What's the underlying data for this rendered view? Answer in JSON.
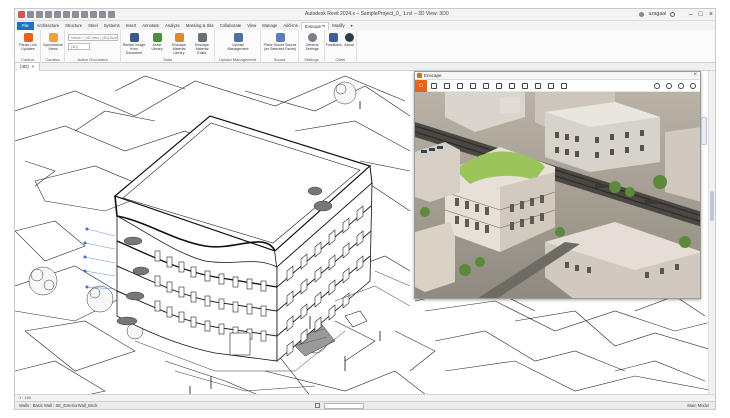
{
  "window": {
    "title": "Autodesk Revit 2024.x – SampleProject_0_ 1.rvt – 3D View: 3D0",
    "user": "uzagaai",
    "controls": [
      "minimize",
      "maximize",
      "close"
    ]
  },
  "ribbon": {
    "tabs": [
      "File",
      "Architecture",
      "Structure",
      "Steel",
      "Systems",
      "Insert",
      "Annotate",
      "Analyze",
      "Massing & Site",
      "Collaborate",
      "View",
      "Manage",
      "Add-Ins",
      "Enscape™",
      "Modify",
      "▾"
    ],
    "active_tab": "Enscape™",
    "groups": [
      {
        "title": "Control",
        "tools": [
          "Pause Live Updates"
        ]
      },
      {
        "title": "Camera",
        "tools": [
          "Synchronize Views"
        ]
      },
      {
        "title": "Active Document",
        "fields": [
          "Views / ( 3D View ) {3D} Active",
          "{3D}"
        ]
      },
      {
        "title": "Tools",
        "tools": [
          "Render Image from Document",
          "Asset Library",
          "Enscape Material Library",
          "Enscape Material Editor"
        ]
      },
      {
        "title": "Upload Management",
        "tools": [
          "Upload Management"
        ]
      },
      {
        "title": "Sound",
        "tools": [
          "Place Sound Source (on Selected Faces)"
        ]
      },
      {
        "title": "Settings",
        "tools": [
          "General Settings"
        ]
      },
      {
        "title": "Other",
        "tools": [
          "Feedback",
          "About"
        ]
      }
    ]
  },
  "view": {
    "tab_label": "{3D}",
    "close_glyph": "×"
  },
  "enscape": {
    "window_title": "Enscape",
    "accent": "#e8641b",
    "home_glyph": "⌂",
    "close_glyph": "×"
  },
  "view_control": "1 : 100",
  "status": {
    "left": "Walls : Basic Wall : SE_ExteriorWall_Brick",
    "right": "Main Model"
  },
  "icons": [
    "save-icon",
    "undo-icon",
    "redo-icon",
    "print-icon",
    "home-icon",
    "search-icon",
    "camera-icon",
    "sun-icon",
    "settings-icon",
    "help-icon"
  ]
}
